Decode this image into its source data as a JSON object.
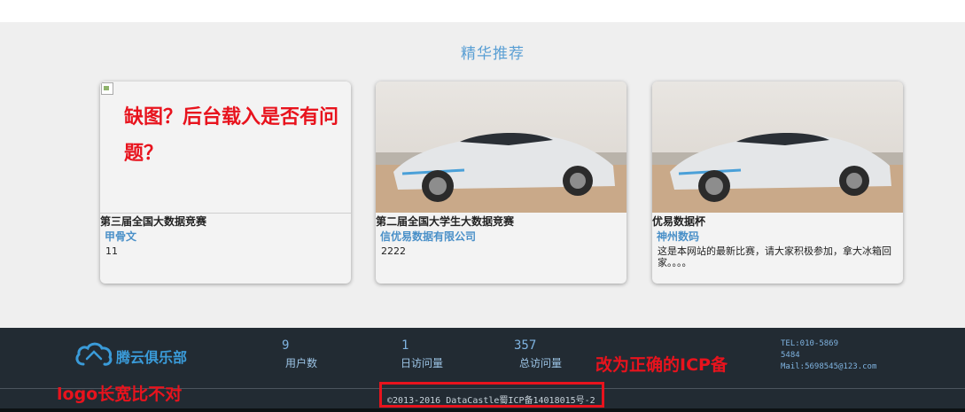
{
  "section": {
    "title": "精华推荐"
  },
  "cards": [
    {
      "title": "第三届全国大数据竞赛",
      "org": "甲骨文",
      "desc": "11",
      "image": "broken-image"
    },
    {
      "title": "第二届全国大学生大数据竞赛",
      "org": "信优易数据有限公司",
      "desc": "2222",
      "image": "car-photo"
    },
    {
      "title": "优易数据杯",
      "org": "神州数码",
      "desc": "这是本网站的最新比赛，请大家积极参加，拿大冰箱回家。。。。",
      "image": "car-photo"
    }
  ],
  "annotations": {
    "broken_image": "缺图？后台载入是否有问题？",
    "icp": "改为正确的ICP备",
    "logo": "logo长宽比不对"
  },
  "footer": {
    "logo_text": "腾云俱乐部",
    "logo_icon": "cloud-icon",
    "stats": [
      {
        "value": "9",
        "label": "用户数"
      },
      {
        "value": "1",
        "label": "日访问量"
      },
      {
        "value": "357",
        "label": "总访问量"
      }
    ],
    "contact": {
      "tel": "TEL:010-58695484",
      "mail": "Mail:5698545@123.com"
    },
    "copyright": "©2013-2016 DataCastle蜀ICP备14018015号-2"
  },
  "colors": {
    "accent": "#5a9fd4",
    "footer_bg": "#222b33",
    "annotation": "#e8131d"
  }
}
